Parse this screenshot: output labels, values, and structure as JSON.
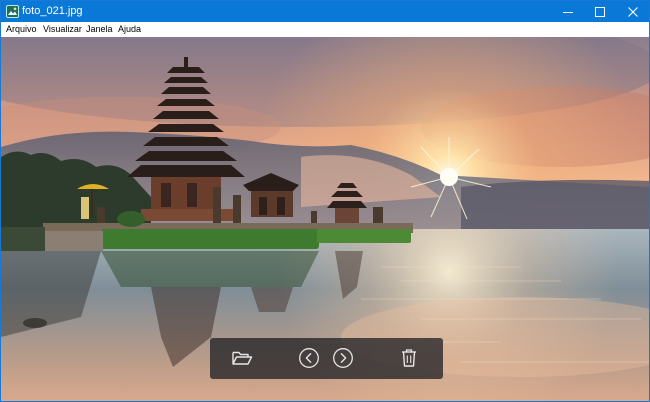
{
  "window": {
    "title": "foto_021.jpg",
    "icons": {
      "app": "app-photo-icon",
      "minimize": "minimize-icon",
      "maximize": "maximize-icon",
      "close": "close-icon"
    },
    "accent_color": "#0a78d7"
  },
  "menu": {
    "items": [
      {
        "label": "Arquivo"
      },
      {
        "label": "Visualizar"
      },
      {
        "label": "Janela"
      },
      {
        "label": "Ajuda"
      }
    ]
  },
  "toolbar": {
    "buttons": [
      {
        "icon": "folder-open-icon"
      },
      {
        "icon": "previous-icon"
      },
      {
        "icon": "next-icon"
      },
      {
        "icon": "delete-icon"
      }
    ],
    "background": "#242428"
  }
}
